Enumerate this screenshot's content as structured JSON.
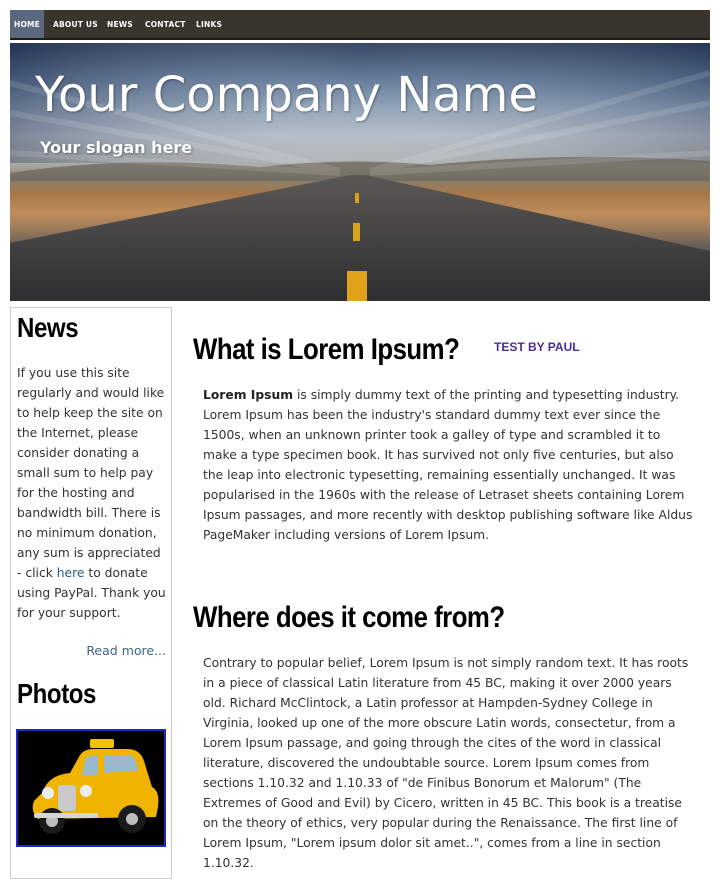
{
  "nav": {
    "items": [
      {
        "label": "HOME",
        "active": true
      },
      {
        "label": "ABOUT US"
      },
      {
        "label": "NEWS"
      },
      {
        "label": "CONTACT"
      },
      {
        "label": "LINKS"
      }
    ]
  },
  "header": {
    "title": "Your Company Name",
    "slogan": "Your slogan here"
  },
  "sidebar": {
    "news_heading": "News",
    "news_text_before_link": "If you use this site regularly and would like to help keep the site on the Internet, please consider donating a small sum to help pay for the hosting and bandwidth bill. There is no minimum donation, any sum is appreciated - click",
    "news_link": "here",
    "news_text_after_link": "to donate using PayPal. Thank you for your support.",
    "read_more": "Read more...",
    "photos_heading": "Photos",
    "photo_icon": "taxi-car-photo"
  },
  "main": {
    "sections": [
      {
        "heading": "What is Lorem Ipsum?",
        "bold_lead": "Lorem Ipsum",
        "text": "is simply dummy text of the printing and typesetting industry. Lorem Ipsum has been the industry's standard dummy text ever since the 1500s, when an unknown printer took a galley of type and scrambled it to make a type specimen book. It has survived not only five centuries, but also the leap into electronic typesetting, remaining essentially unchanged. It was popularised in the 1960s with the release of Letraset sheets containing Lorem Ipsum passages, and more recently with desktop publishing software like Aldus PageMaker including versions of Lorem Ipsum."
      },
      {
        "heading": "Where does it come from?",
        "text": "Contrary to popular belief, Lorem Ipsum is not simply random text. It has roots in a piece of classical Latin literature from 45 BC, making it over 2000 years old. Richard McClintock, a Latin professor at Hampden-Sydney College in Virginia, looked up one of the more obscure Latin words, consectetur, from a Lorem Ipsum passage, and going through the cites of the word in classical literature, discovered the undoubtable source. Lorem Ipsum comes from sections 1.10.32 and 1.10.33 of \"de Finibus Bonorum et Malorum\" (The Extremes of Good and Evil) by Cicero, written in 45 BC. This book is a treatise on the theory of ethics, very popular during the Renaissance. The first line of Lorem Ipsum, \"Lorem ipsum dolor sit amet..\", comes from a line in section 1.10.32."
      }
    ],
    "test_tag": "TEST BY PAUL"
  },
  "colors": {
    "nav_bg": "#39342c",
    "nav_active": "#5a677c",
    "link": "#2a5b8c",
    "photo_border": "#1a2acb",
    "test_tag": "#4a2c9a"
  }
}
